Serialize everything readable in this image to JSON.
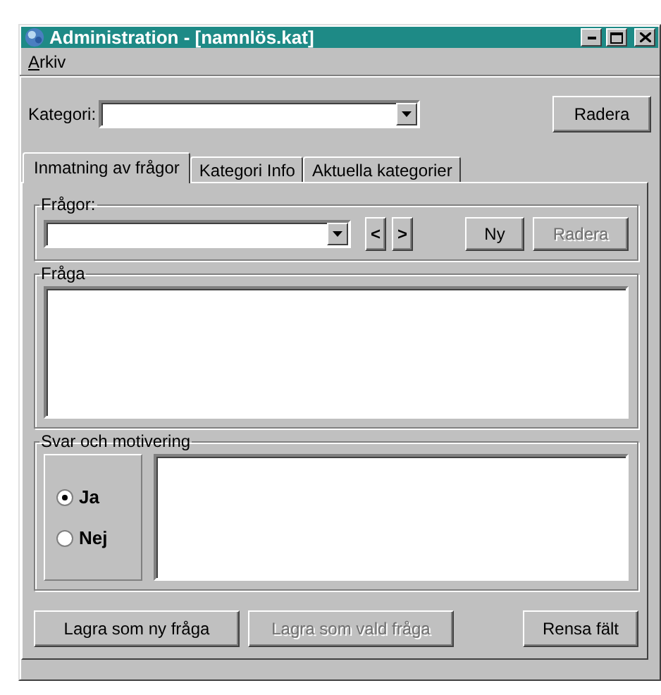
{
  "window": {
    "title": "Administration - [namnlös.kat]"
  },
  "menu": [
    {
      "label": "Arkiv"
    }
  ],
  "category": {
    "label": "Kategori:",
    "button": "Radera"
  },
  "tabs": [
    {
      "label": "Inmatning av frågor",
      "selected": true
    },
    {
      "label": "Kategori Info",
      "selected": false
    },
    {
      "label": "Aktuella kategorier",
      "selected": false
    }
  ],
  "questions_group": {
    "title": "Frågor:",
    "prev": "<",
    "next": ">",
    "buttons": [
      {
        "label": "Ny",
        "disabled": false
      },
      {
        "label": "Radera",
        "disabled": true
      }
    ]
  },
  "question_group": {
    "title": "Fråga"
  },
  "answer_group": {
    "title": "Svar och motivering",
    "options": [
      {
        "label": "Ja",
        "selected": true
      },
      {
        "label": "Nej",
        "selected": false
      }
    ]
  },
  "bottom_buttons": [
    {
      "label": "Lagra som ny fråga",
      "disabled": false
    },
    {
      "label": "Lagra som vald fråga",
      "disabled": true
    },
    {
      "label": "Rensa fält",
      "disabled": false
    }
  ]
}
